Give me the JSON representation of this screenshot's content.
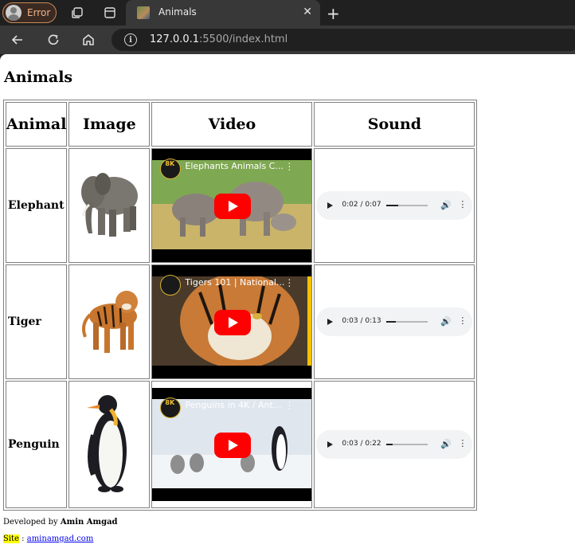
{
  "browser": {
    "profile_label": "Error",
    "tab_title": "Animals",
    "url_host": "127.0.0.1",
    "url_rest": ":5500/index.html"
  },
  "page": {
    "title": "Animals",
    "headers": [
      "Animal",
      "Image",
      "Video",
      "Sound"
    ],
    "rows": [
      {
        "name": "Elephant",
        "video_title": "Elephants Animals C...",
        "channel_badge": "8K",
        "audio_time": "0:02 / 0:07",
        "audio_progress": 0.29
      },
      {
        "name": "Tiger",
        "video_title": "Tigers 101 | National...",
        "channel_badge": "",
        "audio_time": "0:03 / 0:13",
        "audio_progress": 0.23
      },
      {
        "name": "Penguin",
        "video_title": "Penguins in 4K / Ant...",
        "channel_badge": "8K",
        "audio_time": "0:03 / 0:22",
        "audio_progress": 0.14
      }
    ],
    "footer": {
      "developed_prefix": "Developed by ",
      "developer": "Amin Amgad",
      "site_label": "Site",
      "site_sep": " : ",
      "site_link": "aminamgad.com"
    }
  },
  "colors": {
    "youtube_red": "#ff0000",
    "chrome_dark": "#202020",
    "chrome_toolbar": "#383838"
  }
}
